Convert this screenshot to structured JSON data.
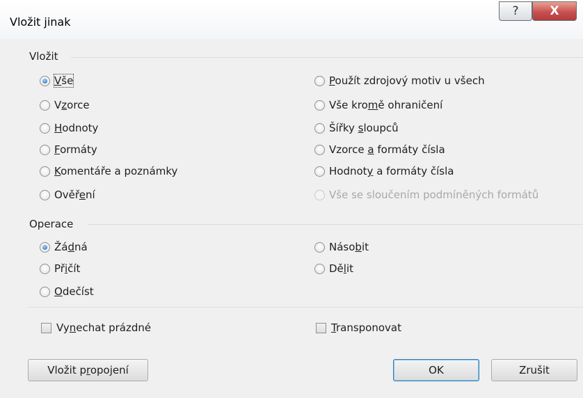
{
  "window": {
    "title": "Vložit jinak",
    "help_glyph": "?",
    "close_glyph": "X"
  },
  "paste_group": {
    "label": "Vložit",
    "options": [
      {
        "pre": "",
        "u": "V",
        "post": "še",
        "checked": true,
        "disabled": false
      },
      {
        "pre": "V",
        "u": "z",
        "post": "orce",
        "checked": false,
        "disabled": false
      },
      {
        "pre": "",
        "u": "H",
        "post": "odnoty",
        "checked": false,
        "disabled": false
      },
      {
        "pre": "",
        "u": "F",
        "post": "ormáty",
        "checked": false,
        "disabled": false
      },
      {
        "pre": "",
        "u": "K",
        "post": "omentáře a poznámky",
        "checked": false,
        "disabled": false
      },
      {
        "pre": "Ověř",
        "u": "e",
        "post": "ní",
        "checked": false,
        "disabled": false
      },
      {
        "pre": "",
        "u": "P",
        "post": "oužít zdrojový motiv u všech",
        "checked": false,
        "disabled": false
      },
      {
        "pre": "Vše kro",
        "u": "m",
        "post": "ě ohraničení",
        "checked": false,
        "disabled": false
      },
      {
        "pre": "Šířky ",
        "u": "s",
        "post": "loupců",
        "checked": false,
        "disabled": false
      },
      {
        "pre": "Vzorce ",
        "u": "a",
        "post": " formáty čísla",
        "checked": false,
        "disabled": false
      },
      {
        "pre": "Hodnot",
        "u": "y",
        "post": " a formáty čísla",
        "checked": false,
        "disabled": false
      },
      {
        "pre": "Vše se sloučením podmíněných formátů",
        "u": "",
        "post": "",
        "checked": false,
        "disabled": true
      }
    ]
  },
  "operation_group": {
    "label": "Operace",
    "options": [
      {
        "pre": "Žá",
        "u": "d",
        "post": "ná",
        "checked": true,
        "disabled": false
      },
      {
        "pre": "Př",
        "u": "i",
        "post": "čít",
        "checked": false,
        "disabled": false
      },
      {
        "pre": "",
        "u": "O",
        "post": "dečíst",
        "checked": false,
        "disabled": false
      },
      {
        "pre": "Náso",
        "u": "b",
        "post": "it",
        "checked": false,
        "disabled": false
      },
      {
        "pre": "Dě",
        "u": "l",
        "post": "it",
        "checked": false,
        "disabled": false
      }
    ]
  },
  "checkboxes": [
    {
      "pre": "Vy",
      "u": "n",
      "post": "echat prázdné",
      "checked": false
    },
    {
      "pre": "",
      "u": "T",
      "post": "ransponovat",
      "checked": false
    }
  ],
  "buttons": {
    "paste_link": {
      "pre": "Vložit p",
      "u": "r",
      "post": "opojení"
    },
    "ok": "OK",
    "cancel": "Zrušit"
  }
}
